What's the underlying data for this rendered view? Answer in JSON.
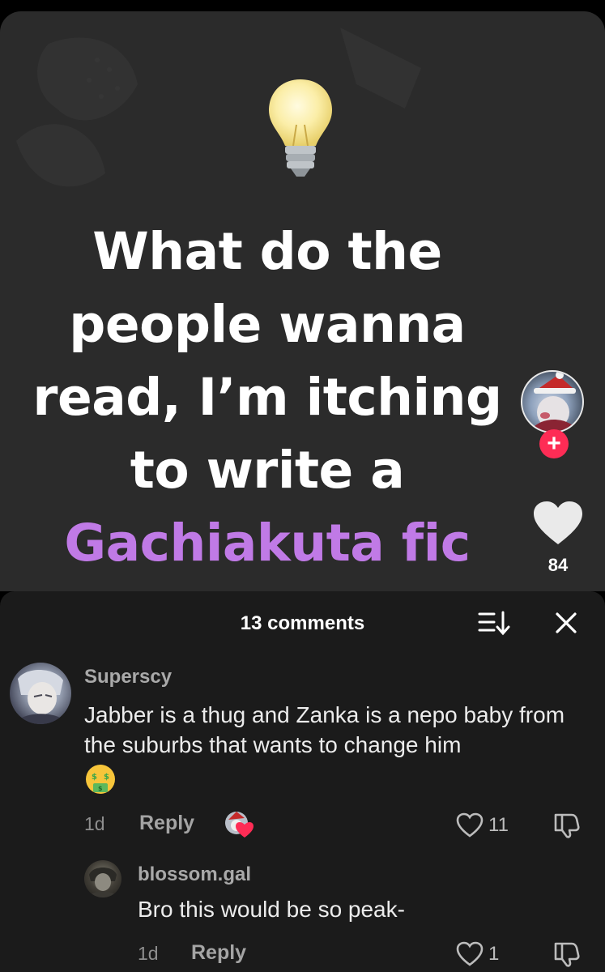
{
  "video": {
    "caption_lines": [
      "What do the",
      "people wanna",
      "read, I’m itching",
      "to write a"
    ],
    "caption_accent": "Gachiakuta fic",
    "accent_color": "#c07ae6",
    "icon": "lightbulb-icon",
    "creator_follow_icon": "plus-icon",
    "like_count": "84"
  },
  "comments_panel": {
    "title": "13 comments",
    "sort_icon": "sort-icon",
    "close_icon": "close-icon",
    "comments": [
      {
        "username": "Superscy",
        "text": "Jabber is a thug and Zanka is a nepo baby from the suburbs that wants to change him",
        "emoji": "money-mouth-face-icon",
        "time": "1d",
        "reply_label": "Reply",
        "likes": "11",
        "liked_by_creator": true
      },
      {
        "username": "blossom.gal",
        "text": "Bro this would be so peak-",
        "time": "1d",
        "reply_label": "Reply",
        "likes": "1"
      }
    ]
  },
  "colors": {
    "follow_button": "#fe2c55",
    "sheet_background": "#1b1b1b",
    "video_background": "#2b2b2b"
  }
}
